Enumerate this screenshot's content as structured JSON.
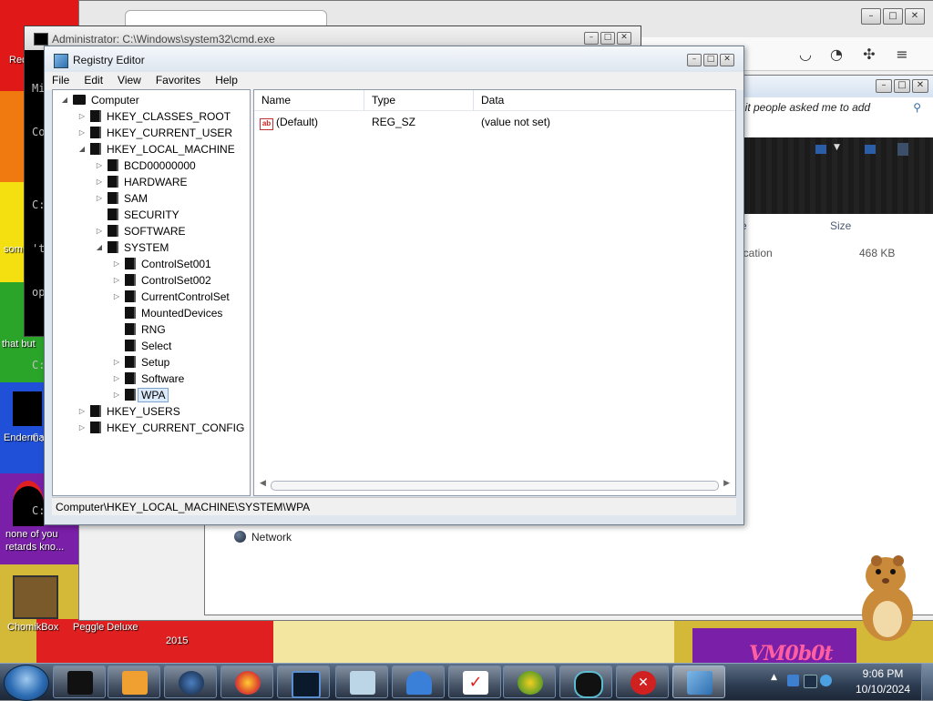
{
  "desktop": {
    "icon_labels": [
      "Rec",
      "som",
      "that but",
      "Enderma",
      "none of you retards kno...",
      "ChomikBox",
      "Peggle Deluxe",
      "2015"
    ],
    "logo_text": "VM0b0t"
  },
  "background_window": {
    "search_text": "shit people asked me to add",
    "column_size": "Size",
    "column_type_partial": "e",
    "file_type": "ication",
    "file_size": "468 KB",
    "network_label": "Network"
  },
  "cmd": {
    "title": "Administrator: C:\\Windows\\system32\\cmd.exe",
    "lines": [
      "Mi",
      "Co",
      "",
      "C:",
      "'t",
      "op",
      "",
      "C:",
      "",
      "C:",
      "",
      "C:"
    ]
  },
  "regedit": {
    "title": "Registry Editor",
    "menu": [
      "File",
      "Edit",
      "View",
      "Favorites",
      "Help"
    ],
    "tree": [
      {
        "label": "Computer",
        "depth": 0,
        "toggle": "◢",
        "kind": "computer"
      },
      {
        "label": "HKEY_CLASSES_ROOT",
        "depth": 1,
        "toggle": "▷"
      },
      {
        "label": "HKEY_CURRENT_USER",
        "depth": 1,
        "toggle": "▷"
      },
      {
        "label": "HKEY_LOCAL_MACHINE",
        "depth": 1,
        "toggle": "◢"
      },
      {
        "label": "BCD00000000",
        "depth": 2,
        "toggle": "▷"
      },
      {
        "label": "HARDWARE",
        "depth": 2,
        "toggle": "▷"
      },
      {
        "label": "SAM",
        "depth": 2,
        "toggle": "▷"
      },
      {
        "label": "SECURITY",
        "depth": 2,
        "toggle": ""
      },
      {
        "label": "SOFTWARE",
        "depth": 2,
        "toggle": "▷"
      },
      {
        "label": "SYSTEM",
        "depth": 2,
        "toggle": "◢"
      },
      {
        "label": "ControlSet001",
        "depth": 3,
        "toggle": "▷"
      },
      {
        "label": "ControlSet002",
        "depth": 3,
        "toggle": "▷"
      },
      {
        "label": "CurrentControlSet",
        "depth": 3,
        "toggle": "▷"
      },
      {
        "label": "MountedDevices",
        "depth": 3,
        "toggle": ""
      },
      {
        "label": "RNG",
        "depth": 3,
        "toggle": ""
      },
      {
        "label": "Select",
        "depth": 3,
        "toggle": ""
      },
      {
        "label": "Setup",
        "depth": 3,
        "toggle": "▷"
      },
      {
        "label": "Software",
        "depth": 3,
        "toggle": "▷"
      },
      {
        "label": "WPA",
        "depth": 3,
        "toggle": "▷",
        "selected": true
      },
      {
        "label": "HKEY_USERS",
        "depth": 1,
        "toggle": "▷"
      },
      {
        "label": "HKEY_CURRENT_CONFIG",
        "depth": 1,
        "toggle": "▷"
      }
    ],
    "columns": {
      "name": "Name",
      "type": "Type",
      "data": "Data"
    },
    "values": [
      {
        "name": "(Default)",
        "type": "REG_SZ",
        "data": "(value not set)",
        "icon": "string-value-icon"
      }
    ],
    "status_path": "Computer\\HKEY_LOCAL_MACHINE\\SYSTEM\\WPA"
  },
  "taskbar": {
    "clock_time": "9:06 PM",
    "clock_date": "10/10/2024",
    "items": [
      "cmd-icon",
      "media-player-icon",
      "globe-icon",
      "firefox-icon",
      "monitor-icon",
      "notepad-icon",
      "shark-icon",
      "checklist-icon",
      "game-icon",
      "portal-icon",
      "close-app-icon",
      "registry-icon"
    ]
  }
}
